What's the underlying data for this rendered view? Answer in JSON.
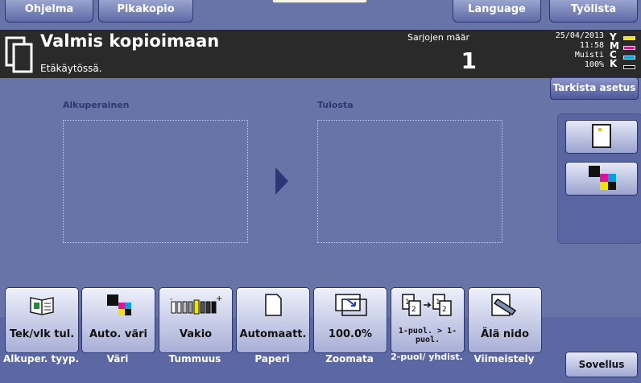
{
  "top_tabs": {
    "ohjelma": "Ohjelma",
    "pikakopio": "Pikakopio",
    "language": "Language",
    "tyolista": "Työlista"
  },
  "status": {
    "title": "Valmis kopioimaan",
    "subtitle": "Etäkäytössä.",
    "sarjat_label": "Sarjojen määr",
    "sarjat_value": "1",
    "date": "25/04/2013",
    "time": "11:58",
    "memory_label": "Muisti",
    "memory_value": "100%",
    "toner_letters": [
      "Y",
      "M",
      "C",
      "K"
    ],
    "toner_colors": [
      "#f2e600",
      "#e0109a",
      "#00a0e0",
      "#111111"
    ]
  },
  "tarkista_label": "Tarkista asetus",
  "preview": {
    "original_label": "Alkuperainen",
    "output_label": "Tulosta"
  },
  "functions": [
    {
      "value": "Tek/vlk tul.",
      "caption": "Alkuper. tyyp.",
      "icon": "original-type-icon"
    },
    {
      "value": "Auto. väri",
      "caption": "Väri",
      "icon": "color-mode-icon"
    },
    {
      "value": "Vakio",
      "caption": "Tummuus",
      "icon": "density-icon"
    },
    {
      "value": "Automaatt.",
      "caption": "Paperi",
      "icon": "paper-icon"
    },
    {
      "value": "100.0%",
      "caption": "Zoomata",
      "icon": "zoom-icon"
    },
    {
      "value": "1-puol. > 1-puol.",
      "caption": "2-puol/ yhdist.",
      "icon": "duplex-combine-icon"
    },
    {
      "value": "Älä nido",
      "caption": "Viimeistely",
      "icon": "finishing-icon"
    }
  ],
  "sovellus_label": "Sovellus"
}
